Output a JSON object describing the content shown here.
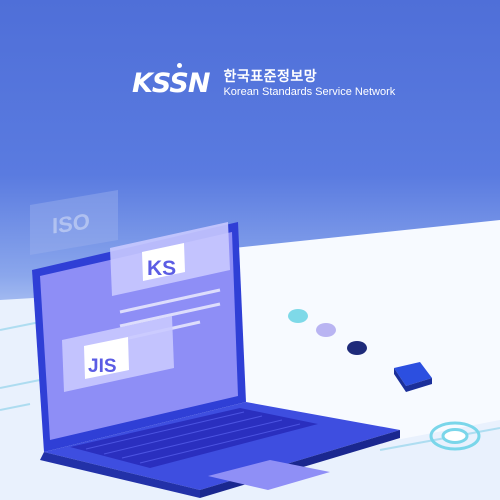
{
  "brand": {
    "logo": "KSSN",
    "name_ko": "한국표준정보망",
    "name_en": "Korean Standards Service Network"
  },
  "illustration": {
    "tiles": [
      "ISO",
      "KS",
      "JIS"
    ],
    "icons": [
      "keyboard-icon",
      "touchpad-icon",
      "target-icon"
    ]
  },
  "colors": {
    "background": "#4f6fd8",
    "screen": "#8f8ff6",
    "keyboard": "#3c41d8",
    "accent_cyan": "#7fd6ec",
    "accent_navy": "#1f2f8a"
  }
}
